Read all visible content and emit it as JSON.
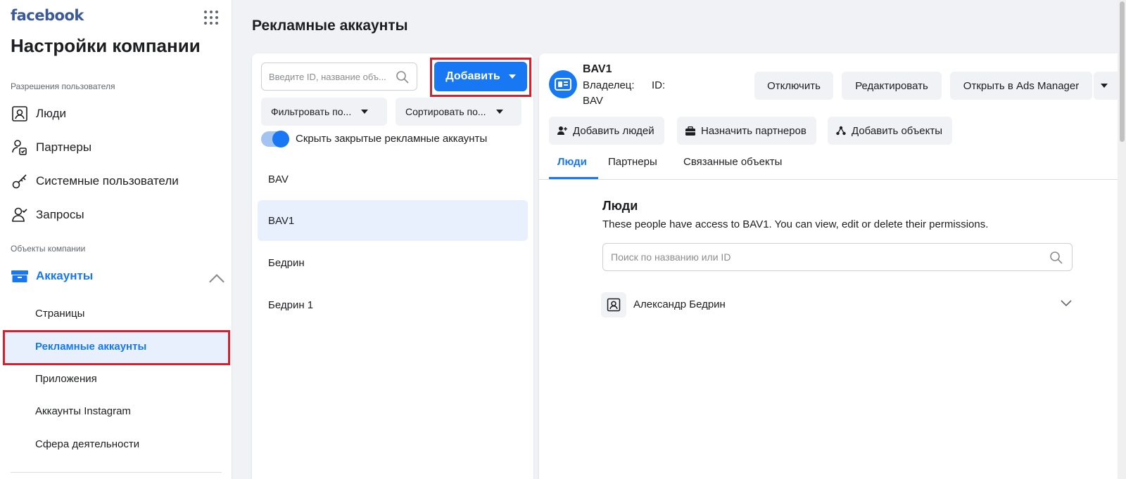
{
  "sidebar": {
    "brand": "facebook",
    "title": "Настройки компании",
    "section_users": "Разрешения пользователя",
    "nav": {
      "people": "Люди",
      "partners": "Партнеры",
      "system_users": "Системные пользователи",
      "requests": "Запросы"
    },
    "section_objects": "Объекты компании",
    "accounts": "Аккаунты",
    "sub": {
      "pages": "Страницы",
      "ad_accounts": "Рекламные аккаунты",
      "apps": "Приложения",
      "instagram": "Аккаунты Instagram",
      "lines_of_business": "Сфера деятельности"
    }
  },
  "main": {
    "title": "Рекламные аккаунты",
    "list": {
      "search_placeholder": "Введите ID, название объ...",
      "add_label": "Добавить",
      "filter_label": "Фильтровать по...",
      "sort_label": "Сортировать по...",
      "toggle_label": "Скрыть закрытые рекламные аккаунты",
      "toggle_on": true,
      "accounts": [
        "BAV",
        "BAV1",
        "Бедрин",
        "Бедрин 1"
      ],
      "selected": "BAV1"
    },
    "detail": {
      "name": "BAV1",
      "owner_label": "Владелец:",
      "id_label": "ID:",
      "owner_value": "BAV",
      "btn_disable": "Отключить",
      "btn_edit": "Редактировать",
      "btn_open_ads": "Открыть в Ads Manager",
      "btn_add_people": "Добавить людей",
      "btn_assign_partners": "Назначить партнеров",
      "btn_add_assets": "Добавить объекты",
      "tabs": [
        "Люди",
        "Партнеры",
        "Связанные объекты"
      ],
      "people_title": "Люди",
      "people_desc": "These people have access to BAV1. You can view, edit or delete their permissions.",
      "people_search_placeholder": "Поиск по названию или ID",
      "person_name": "Александр Бедрин"
    }
  },
  "colors": {
    "accent": "#1877f2",
    "highlight_border": "#d0232f",
    "selected_bg": "#e7f0fc"
  }
}
